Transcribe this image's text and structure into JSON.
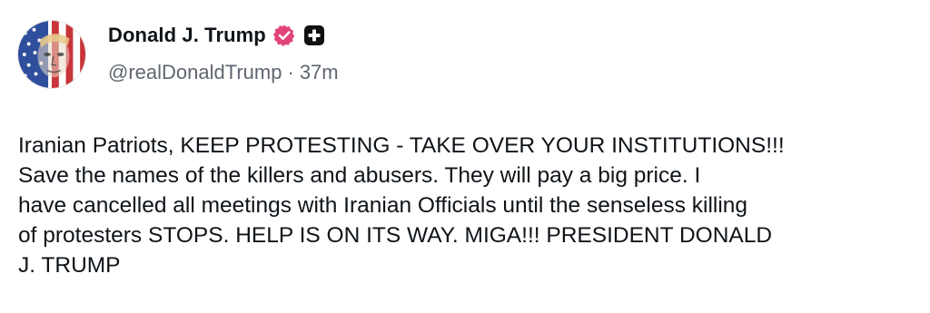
{
  "post": {
    "author": {
      "display_name": "Donald J. Trump",
      "handle": "@realDonaldTrump",
      "verified_icon": "verified-badge-icon",
      "plus_icon": "plus-badge-icon"
    },
    "timestamp": "37m",
    "separator": "·",
    "body": "Iranian Patriots, KEEP PROTESTING - TAKE OVER YOUR INSTITUTIONS!!!\nSave the names of the killers and abusers. They will pay a big price. I\nhave cancelled all meetings with Iranian Officials until the senseless killing\nof protesters STOPS. HELP IS ON ITS WAY. MIGA!!! PRESIDENT DONALD\nJ. TRUMP"
  },
  "colors": {
    "verified_badge": "#e0447a",
    "plus_badge": "#111111",
    "handle_text": "#5f6670",
    "body_text": "#0f1419"
  }
}
